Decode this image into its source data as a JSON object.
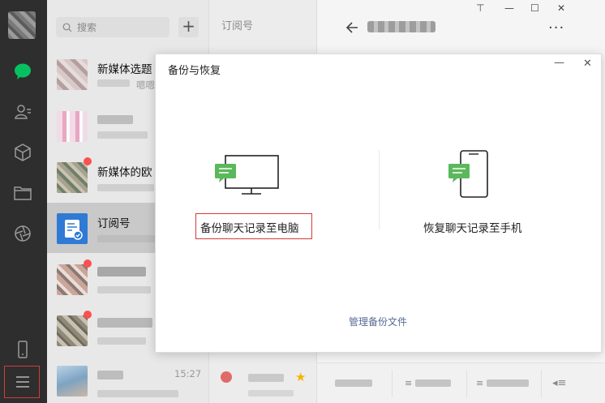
{
  "list": {
    "search_placeholder": "搜索",
    "add_label": "+",
    "items": [
      {
        "title": "新媒体选题",
        "preview": "嗯嗯",
        "time": ""
      },
      {
        "title": "",
        "preview": "",
        "time": ""
      },
      {
        "title": "新媒体的欧",
        "preview": "",
        "time": ""
      },
      {
        "title": "订阅号",
        "preview": "",
        "time": ""
      },
      {
        "title": "",
        "preview": "",
        "time": ""
      },
      {
        "title": "",
        "preview": "",
        "time": ""
      },
      {
        "title": "",
        "preview": "",
        "time": "15:27"
      }
    ]
  },
  "subscription": {
    "title": "订阅号"
  },
  "window": {
    "pin": "⊤",
    "minimize": "—",
    "maximize": "☐",
    "close": "✕",
    "more": "···"
  },
  "dialog": {
    "title": "备份与恢复",
    "minimize": "—",
    "close": "✕",
    "backup_label": "备份聊天记录至电脑",
    "restore_label": "恢复聊天记录至手机",
    "manage_link": "管理备份文件"
  },
  "colors": {
    "nav_bg": "#2e2e2e",
    "accent_green": "#07c160",
    "highlight_red": "#d23b3b",
    "link_blue": "#576b95",
    "unread_dot": "#fa5151"
  },
  "icons": {
    "chat": "chat-bubble-icon",
    "contacts": "contacts-icon",
    "favorites": "cube-icon",
    "files": "folder-icon",
    "moments": "aperture-icon",
    "phone": "phone-icon",
    "menu": "hamburger-menu-icon"
  }
}
